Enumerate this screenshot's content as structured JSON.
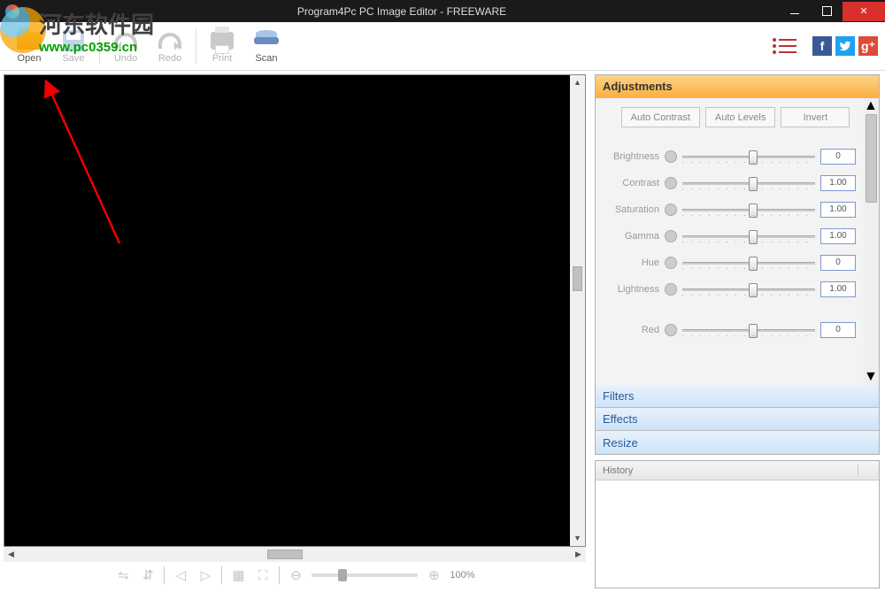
{
  "titlebar": {
    "title": "Program4Pc PC Image Editor - FREEWARE"
  },
  "watermark": {
    "text": "河东软件园",
    "url": "www.pc0359.cn"
  },
  "toolbar": {
    "open": "Open",
    "save": "Save",
    "undo": "Undo",
    "redo": "Redo",
    "print": "Print",
    "scan": "Scan"
  },
  "zoom": {
    "percent": "100%"
  },
  "adjustments": {
    "header": "Adjustments",
    "buttons": {
      "auto_contrast": "Auto Contrast",
      "auto_levels": "Auto Levels",
      "invert": "Invert"
    },
    "sliders": [
      {
        "label": "Brightness",
        "value": "0",
        "pos": 50
      },
      {
        "label": "Contrast",
        "value": "1.00",
        "pos": 50
      },
      {
        "label": "Saturation",
        "value": "1.00",
        "pos": 50
      },
      {
        "label": "Gamma",
        "value": "1.00",
        "pos": 50
      },
      {
        "label": "Hue",
        "value": "0",
        "pos": 50
      },
      {
        "label": "Lightness",
        "value": "1.00",
        "pos": 50
      }
    ],
    "extra_sliders": [
      {
        "label": "Red",
        "value": "0",
        "pos": 50
      }
    ]
  },
  "sections": {
    "filters": "Filters",
    "effects": "Effects",
    "resize": "Resize"
  },
  "history": {
    "header": "History"
  }
}
